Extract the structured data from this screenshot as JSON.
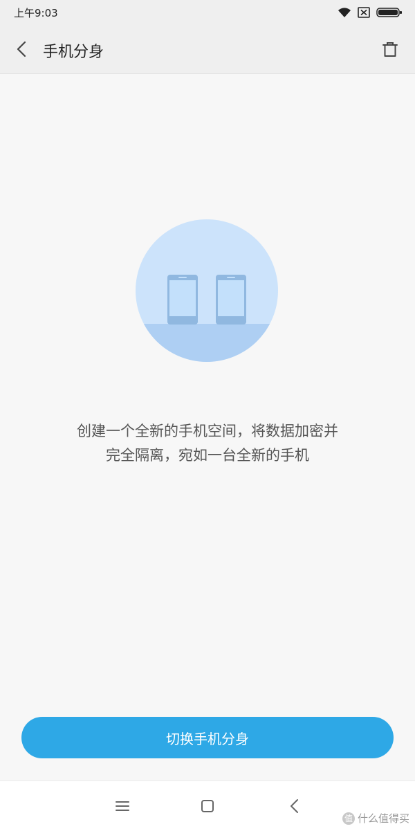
{
  "status_bar": {
    "time": "上午9:03",
    "icons": [
      "wifi-icon",
      "sim-x-icon",
      "battery-icon"
    ]
  },
  "header": {
    "title": "手机分身",
    "back_icon": "chevron-left-icon",
    "delete_icon": "trash-icon"
  },
  "main": {
    "illustration": "two-phones-illustration",
    "description_line1": "创建一个全新的手机空间，将数据加密并",
    "description_line2": "完全隔离，宛如一台全新的手机"
  },
  "action": {
    "button_label": "切换手机分身"
  },
  "nav_bar": {
    "icons": [
      "menu-icon",
      "home-icon",
      "back-icon"
    ]
  },
  "watermark": {
    "text": "什么值得买",
    "badge": "值"
  },
  "colors": {
    "accent": "#2ea8e6",
    "illustration_circle": "#cce3fb",
    "illustration_floor": "#aecff3",
    "phone_screen": "#c3e0fb",
    "phone_body": "#90b8e0"
  }
}
